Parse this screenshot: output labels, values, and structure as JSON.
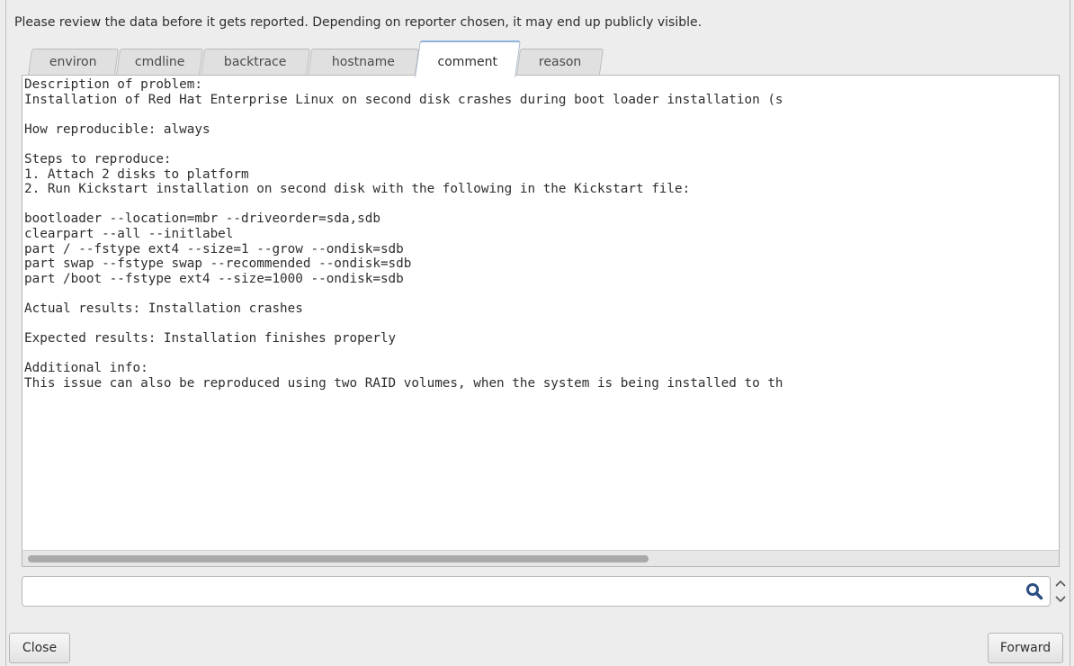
{
  "notice": "Please review the data before it gets reported. Depending on reporter chosen, it may end up publicly visible.",
  "tabs": [
    {
      "label": "environ"
    },
    {
      "label": "cmdline"
    },
    {
      "label": "backtrace"
    },
    {
      "label": "hostname"
    },
    {
      "label": "comment"
    },
    {
      "label": "reason"
    }
  ],
  "active_tab": "comment",
  "content_text": "Description of problem:\nInstallation of Red Hat Enterprise Linux on second disk crashes during boot loader installation (s\n\nHow reproducible: always\n\nSteps to reproduce:\n1. Attach 2 disks to platform\n2. Run Kickstart installation on second disk with the following in the Kickstart file:\n\nbootloader --location=mbr --driveorder=sda,sdb\nclearpart --all --initlabel\npart / --fstype ext4 --size=1 --grow --ondisk=sdb\npart swap --fstype swap --recommended --ondisk=sdb\npart /boot --fstype ext4 --size=1000 --ondisk=sdb\n\nActual results: Installation crashes\n\nExpected results: Installation finishes properly\n\nAdditional info:\nThis issue can also be reproduced using two RAID volumes, when the system is being installed to th",
  "search": {
    "value": ""
  },
  "buttons": {
    "close": "Close",
    "forward": "Forward"
  },
  "icons": {
    "search": "magnifier-icon",
    "spin": "spin-up-down-icon"
  },
  "colors": {
    "active_tab_top": "#8fb2d8",
    "background": "#ededed"
  }
}
